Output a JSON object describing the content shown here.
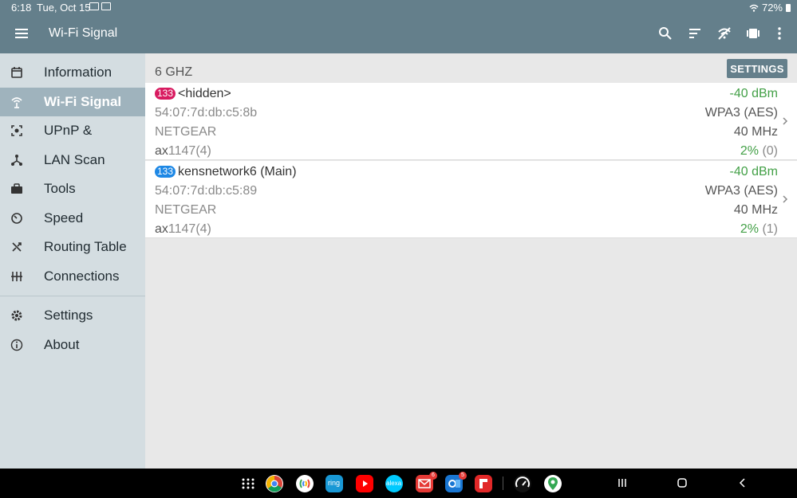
{
  "status_bar": {
    "time": "6:18",
    "date": "Tue, Oct 15",
    "battery": "72%"
  },
  "app_bar": {
    "title": "Wi-Fi Signal",
    "actions": [
      "search-icon",
      "sort-icon",
      "wifi-off-icon",
      "view-icon",
      "more-vert-icon"
    ]
  },
  "sidebar": {
    "items": [
      {
        "label": "Information",
        "icon": "calendar-icon"
      },
      {
        "label": "Wi-Fi Signal",
        "icon": "wifi-tower-icon",
        "active": true
      },
      {
        "label": "UPnP &",
        "icon": "upnp-icon"
      },
      {
        "label": "LAN Scan",
        "icon": "network-icon"
      },
      {
        "label": "Tools",
        "icon": "toolbox-icon"
      },
      {
        "label": "Speed",
        "icon": "speedometer-icon"
      },
      {
        "label": "Routing Table",
        "icon": "routing-icon"
      },
      {
        "label": "Connections",
        "icon": "connections-icon"
      }
    ],
    "footer_items": [
      {
        "label": "Settings",
        "icon": "gear-icon"
      },
      {
        "label": "About",
        "icon": "info-icon"
      }
    ]
  },
  "main": {
    "band": "6 GHZ",
    "settings_label": "SETTINGS",
    "networks": [
      {
        "channel": "133",
        "channel_color": "#d81b60",
        "ssid": "<hidden>",
        "bssid": "54:07:7d:db:c5:8b",
        "vendor": "NETGEAR",
        "standard_prefix": "ax",
        "standard_rest": "1147(4)",
        "signal": "-40 dBm",
        "security": "WPA3 (AES)",
        "width": "40 MHz",
        "quality": "2%",
        "quality_count": "(0)"
      },
      {
        "channel": "133",
        "channel_color": "#1e88e5",
        "ssid": "kensnetwork6 (Main)",
        "bssid": "54:07:7d:db:c5:89",
        "vendor": "NETGEAR",
        "standard_prefix": "ax",
        "standard_rest": "1147(4)",
        "signal": "-40 dBm",
        "security": "WPA3 (AES)",
        "width": "40 MHz",
        "quality": "2%",
        "quality_count": "(1)"
      }
    ]
  },
  "taskbar": {
    "apps": [
      {
        "name": "app-grid-icon"
      },
      {
        "name": "chrome-icon",
        "color": "#ffffff"
      },
      {
        "name": "nearby-icon",
        "color": "#ffffff"
      },
      {
        "name": "ring-icon",
        "color": "#1998d5",
        "text": "ring"
      },
      {
        "name": "youtube-icon",
        "color": "#ff0000"
      },
      {
        "name": "alexa-icon",
        "color": "#00caff",
        "text": "alexa"
      },
      {
        "name": "mail-icon",
        "color": "#e53935",
        "badge": "6"
      },
      {
        "name": "outlook-icon",
        "color": "#1976d2",
        "badge": "5"
      },
      {
        "name": "flipboard-icon",
        "color": "#e12828"
      },
      {
        "name": "speedtest-icon",
        "color": "#111111"
      },
      {
        "name": "maps-icon",
        "color": "#ffffff"
      }
    ]
  }
}
